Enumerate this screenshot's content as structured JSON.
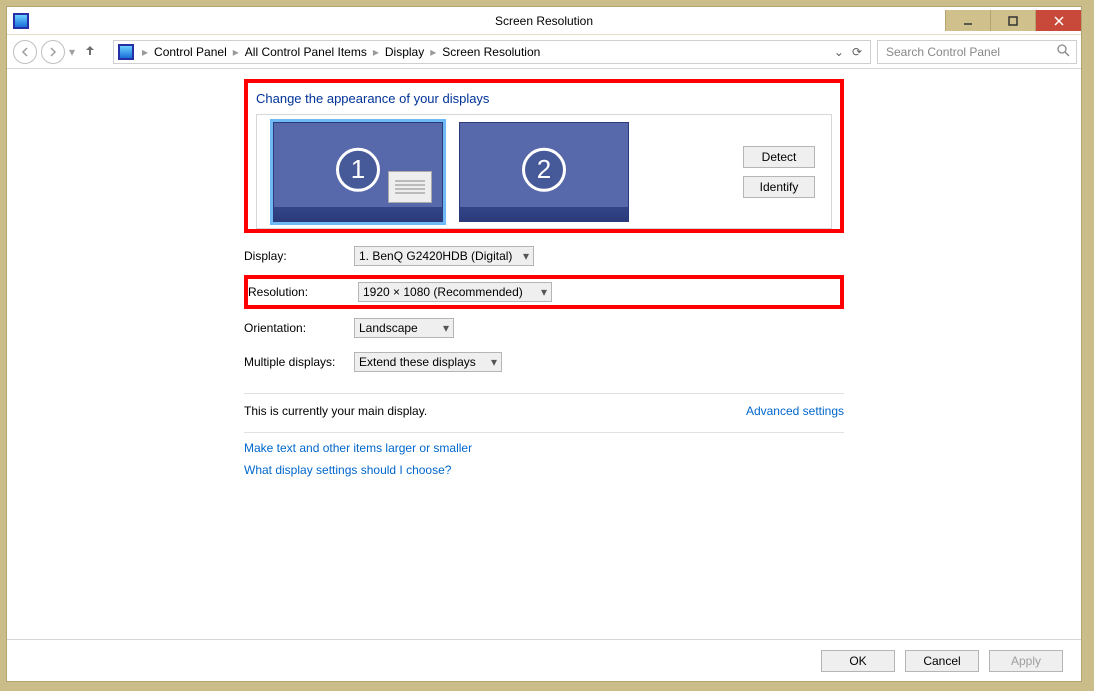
{
  "window": {
    "title": "Screen Resolution"
  },
  "breadcrumb": {
    "items": [
      "Control Panel",
      "All Control Panel Items",
      "Display",
      "Screen Resolution"
    ]
  },
  "search": {
    "placeholder": "Search Control Panel"
  },
  "section": {
    "title": "Change the appearance of your displays"
  },
  "monitor_actions": {
    "detect": "Detect",
    "identify": "Identify"
  },
  "monitor_ids": {
    "one": "1",
    "two": "2"
  },
  "fields": {
    "display_label": "Display:",
    "display_value": "1. BenQ G2420HDB (Digital)",
    "resolution_label": "Resolution:",
    "resolution_value": "1920 × 1080 (Recommended)",
    "orientation_label": "Orientation:",
    "orientation_value": "Landscape",
    "multiple_label": "Multiple displays:",
    "multiple_value": "Extend these displays"
  },
  "info": {
    "main_display": "This is currently your main display.",
    "advanced": "Advanced settings",
    "link1": "Make text and other items larger or smaller",
    "link2": "What display settings should I choose?"
  },
  "footer": {
    "ok": "OK",
    "cancel": "Cancel",
    "apply": "Apply"
  }
}
